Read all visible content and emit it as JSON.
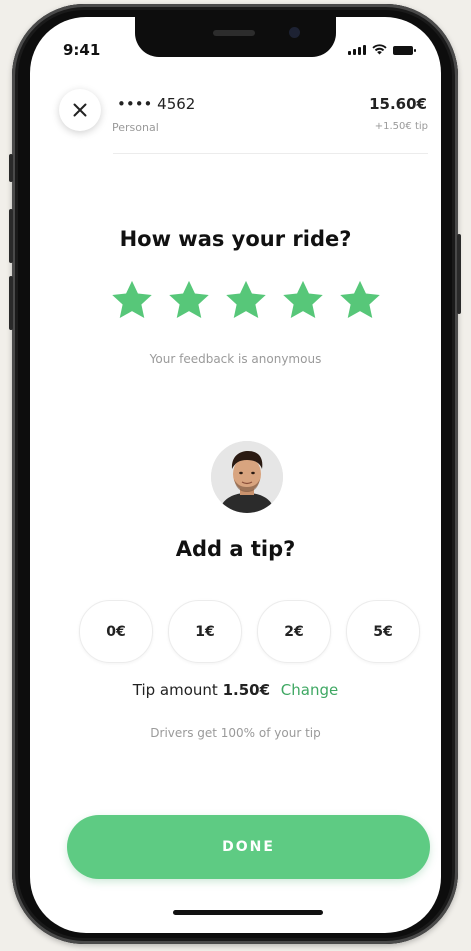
{
  "status_bar": {
    "time": "9:41"
  },
  "header": {
    "card_masked": "•••• 4562",
    "card_type": "Personal",
    "price": "15.60€",
    "tip_note": "+1.50€ tip"
  },
  "rating": {
    "question": "How was your ride?",
    "stars_selected": 5,
    "stars_total": 5,
    "feedback_note": "Your feedback is anonymous"
  },
  "tip": {
    "question": "Add a tip?",
    "options": [
      "0€",
      "1€",
      "2€",
      "5€"
    ],
    "amount_label": "Tip amount",
    "amount_value": "1.50€",
    "change_label": "Change",
    "drivers_note": "Drivers get 100% of your tip"
  },
  "actions": {
    "done_label": "DONE"
  },
  "colors": {
    "accent_green": "#5ecb83",
    "star_green": "#57c779",
    "link_green": "#3fa863"
  },
  "icons": {
    "close": "close-icon",
    "star": "star-icon",
    "signal": "signal-icon",
    "wifi": "wifi-icon",
    "battery": "battery-icon"
  }
}
